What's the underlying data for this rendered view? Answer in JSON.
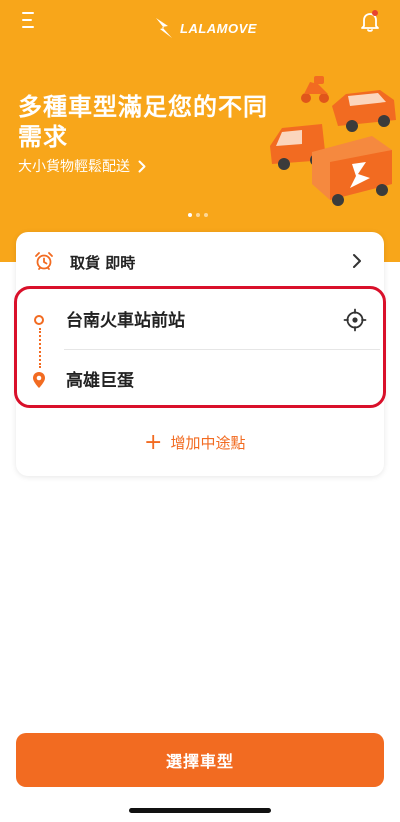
{
  "app": {
    "logo_text": "LALAMOVE"
  },
  "hero": {
    "title": "多種車型滿足您的不同需求",
    "subtitle": "大小貨物輕鬆配送",
    "carousel_dots": 3,
    "active_dot": 1
  },
  "order": {
    "pickup_label": "取貨  即時",
    "origin": "台南火車站前站",
    "destination": "高雄巨蛋",
    "add_stop_label": "增加中途點"
  },
  "footer": {
    "cta_label": "選擇車型"
  },
  "colors": {
    "brand_orange": "#f26b21",
    "hero_yellow": "#f8a61a",
    "highlight_red": "#d9102a",
    "notification_dot": "#e8432f"
  },
  "icons": [
    "menu-icon",
    "lalamove-logo-icon",
    "bell-icon",
    "chevron-right-icon",
    "alarm-clock-icon",
    "origin-dot-icon",
    "location-pin-icon",
    "crosshair-target-icon",
    "plus-icon"
  ]
}
